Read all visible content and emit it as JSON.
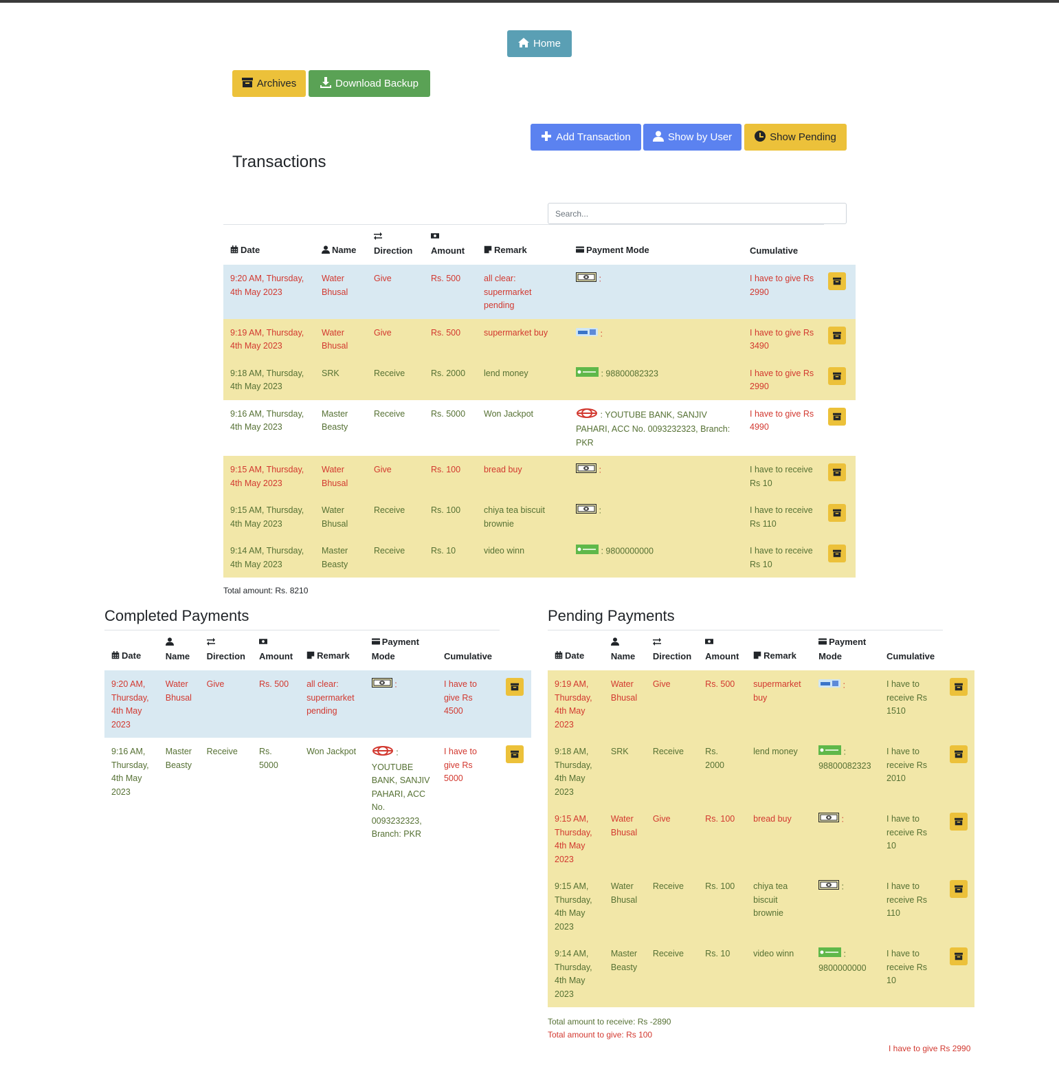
{
  "nav": {
    "home_label": "Home",
    "archives_label": "Archives",
    "download_label": "Download Backup"
  },
  "actions": {
    "add_label": "Add Transaction",
    "by_user_label": "Show by User",
    "pending_label": "Show Pending"
  },
  "page_title": "Transactions",
  "search": {
    "placeholder": "Search..."
  },
  "columns": {
    "date": "Date",
    "name": "Name",
    "direction": "Direction",
    "amount": "Amount",
    "remark": "Remark",
    "payment_mode": "Payment Mode",
    "payment": "Payment",
    "mode": "Mode",
    "cumulative": "Cumulative"
  },
  "transactions": [
    {
      "date": "9:20 AM, Thursday, 4th May 2023",
      "name": "Water Bhusal",
      "direction": "Give",
      "amount": "Rs. 500",
      "remark": "all clear: supermarket pending",
      "mode_icon": "cash-icon",
      "mode_text": ":",
      "cumulative": "I have to give Rs 2990"
    },
    {
      "date": "9:19 AM, Thursday, 4th May 2023",
      "name": "Water Bhusal",
      "direction": "Give",
      "amount": "Rs. 500",
      "remark": "supermarket buy",
      "mode_icon": "card-icon",
      "mode_text": ":",
      "cumulative": "I have to give Rs 3490"
    },
    {
      "date": "9:18 AM, Thursday, 4th May 2023",
      "name": "SRK",
      "direction": "Receive",
      "amount": "Rs. 2000",
      "remark": "lend money",
      "mode_icon": "esewa-icon",
      "mode_text": ": 98800082323",
      "cumulative": "I have to give Rs 2990"
    },
    {
      "date": "9:16 AM, Thursday, 4th May 2023",
      "name": "Master Beasty",
      "direction": "Receive",
      "amount": "Rs. 5000",
      "remark": "Won Jackpot",
      "mode_icon": "bank-icon",
      "mode_text": ": YOUTUBE BANK, SANJIV PAHARI, ACC No. 0093232323, Branch: PKR",
      "cumulative": "I have to give Rs 4990"
    },
    {
      "date": "9:15 AM, Thursday, 4th May 2023",
      "name": "Water Bhusal",
      "direction": "Give",
      "amount": "Rs. 100",
      "remark": "bread buy",
      "mode_icon": "cash-icon",
      "mode_text": ":",
      "cumulative": "I have to receive Rs 10"
    },
    {
      "date": "9:15 AM, Thursday, 4th May 2023",
      "name": "Water Bhusal",
      "direction": "Receive",
      "amount": "Rs. 100",
      "remark": "chiya tea biscuit brownie",
      "mode_icon": "cash-icon",
      "mode_text": ":",
      "cumulative": "I have to receive Rs 110"
    },
    {
      "date": "9:14 AM, Thursday, 4th May 2023",
      "name": "Master Beasty",
      "direction": "Receive",
      "amount": "Rs. 10",
      "remark": "video winn",
      "mode_icon": "esewa-icon",
      "mode_text": ": 9800000000",
      "cumulative": "I have to receive Rs 10"
    }
  ],
  "total_amount": "Total amount: Rs. 8210",
  "completed": {
    "title": "Completed Payments",
    "rows": [
      {
        "date": "9:20 AM, Thursday, 4th May 2023",
        "name": "Water Bhusal",
        "direction": "Give",
        "amount": "Rs. 500",
        "remark": "all clear: supermarket pending",
        "mode_icon": "cash-icon",
        "mode_text": ":",
        "cumulative": "I have to give Rs 4500"
      },
      {
        "date": "9:16 AM, Thursday, 4th May 2023",
        "name": "Master Beasty",
        "direction": "Receive",
        "amount": "Rs. 5000",
        "remark": "Won Jackpot",
        "mode_icon": "bank-icon",
        "mode_text": ": YOUTUBE BANK, SANJIV PAHARI, ACC No. 0093232323, Branch: PKR",
        "cumulative": "I have to give Rs 5000"
      }
    ]
  },
  "pending": {
    "title": "Pending Payments",
    "rows": [
      {
        "date": "9:19 AM, Thursday, 4th May 2023",
        "name": "Water Bhusal",
        "direction": "Give",
        "amount": "Rs. 500",
        "remark": "supermarket buy",
        "mode_icon": "card-icon",
        "mode_text": ":",
        "cumulative": "I have to receive Rs 1510"
      },
      {
        "date": "9:18 AM, Thursday, 4th May 2023",
        "name": "SRK",
        "direction": "Receive",
        "amount": "Rs. 2000",
        "remark": "lend money",
        "mode_icon": "esewa-icon",
        "mode_text": ": 98800082323",
        "cumulative": "I have to receive Rs 2010"
      },
      {
        "date": "9:15 AM, Thursday, 4th May 2023",
        "name": "Water Bhusal",
        "direction": "Give",
        "amount": "Rs. 100",
        "remark": "bread buy",
        "mode_icon": "cash-icon",
        "mode_text": ":",
        "cumulative": "I have to receive Rs 10"
      },
      {
        "date": "9:15 AM, Thursday, 4th May 2023",
        "name": "Water Bhusal",
        "direction": "Receive",
        "amount": "Rs. 100",
        "remark": "chiya tea biscuit brownie",
        "mode_icon": "cash-icon",
        "mode_text": ":",
        "cumulative": "I have to receive Rs 110"
      },
      {
        "date": "9:14 AM, Thursday, 4th May 2023",
        "name": "Master Beasty",
        "direction": "Receive",
        "amount": "Rs. 10",
        "remark": "video winn",
        "mode_icon": "esewa-icon",
        "mode_text": ": 9800000000",
        "cumulative": "I have to receive Rs 10"
      }
    ],
    "total_receive": "Total amount to receive: Rs -2890",
    "total_give": "Total amount to give: Rs 100"
  },
  "summary": "I have to give Rs 2990",
  "colors": {
    "red": "#d2382f",
    "green": "#557033",
    "info_row": "#d9e9f2",
    "warn_row": "#f2e7a8",
    "warning": "#ecc13a",
    "primary": "#5b82f0",
    "success": "#5aa255",
    "info": "#5a9fb4"
  }
}
